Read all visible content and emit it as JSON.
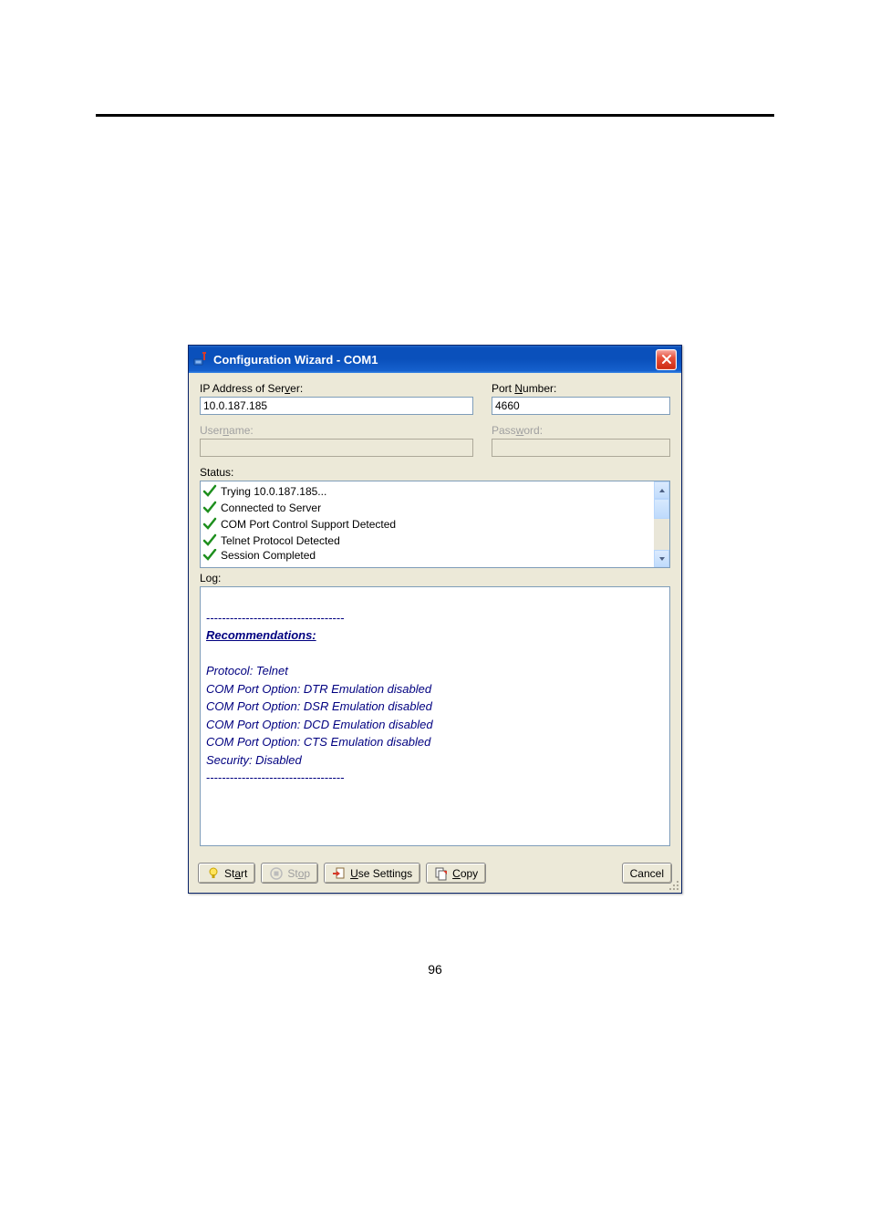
{
  "window": {
    "title": "Configuration Wizard - COM1"
  },
  "form": {
    "ip_label_pre": "IP Address of Ser",
    "ip_label_u": "v",
    "ip_label_post": "er:",
    "ip_value": "10.0.187.185",
    "port_label_pre": "Port ",
    "port_label_u": "N",
    "port_label_post": "umber:",
    "port_value": "4660",
    "user_label_pre": "User",
    "user_label_u": "n",
    "user_label_post": "ame:",
    "user_value": "",
    "pass_label_pre": "Pass",
    "pass_label_u": "w",
    "pass_label_post": "ord:",
    "pass_value": ""
  },
  "status": {
    "label": "Status:",
    "items": [
      "Trying 10.0.187.185...",
      "Connected to Server",
      "COM Port Control Support Detected",
      "Telnet Protocol Detected",
      "Session Completed"
    ]
  },
  "log": {
    "label": "Log:",
    "rec_title": "Recommendations:",
    "lines": [
      "Protocol: Telnet",
      "COM Port Option: DTR Emulation disabled",
      "COM Port Option: DSR Emulation disabled",
      "COM Port Option: DCD Emulation disabled",
      "COM Port Option: CTS Emulation disabled",
      "Security: Disabled"
    ],
    "dashes": "-----------------------------------"
  },
  "buttons": {
    "start_pre": "St",
    "start_u": "a",
    "start_post": "rt",
    "stop_pre": "St",
    "stop_u": "o",
    "stop_post": "p",
    "use_u": "U",
    "use_post": "se Settings",
    "copy_u": "C",
    "copy_post": "opy",
    "cancel": "Cancel"
  },
  "page_number": "96"
}
